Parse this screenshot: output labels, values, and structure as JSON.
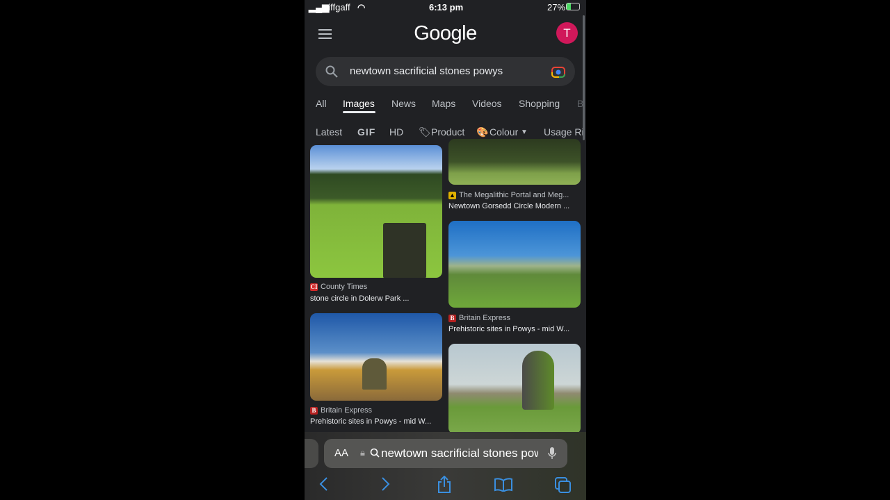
{
  "status_bar": {
    "carrier": "giffgaff",
    "time": "6:13 pm",
    "battery": "27%"
  },
  "header": {
    "logo": "Google",
    "avatar_letter": "T",
    "avatar_color": "#d0185a"
  },
  "search": {
    "query": "newtown sacrificial stones powys"
  },
  "tabs": [
    {
      "label": "All"
    },
    {
      "label": "Images",
      "active": true
    },
    {
      "label": "News"
    },
    {
      "label": "Maps"
    },
    {
      "label": "Videos"
    },
    {
      "label": "Shopping"
    },
    {
      "label": "B"
    }
  ],
  "chips": [
    {
      "label": "Latest"
    },
    {
      "label": "GIF"
    },
    {
      "label": "HD"
    },
    {
      "label": "Product"
    },
    {
      "label": "Colour"
    },
    {
      "label": "Usage Ri"
    }
  ],
  "results": [
    {
      "source": "County Times",
      "favicon": "CI",
      "title": "stone circle in Dolerw Park ..."
    },
    {
      "source": "The Megalithic Portal and Meg...",
      "title": "Newtown Gorsedd Circle Modern ..."
    },
    {
      "source": "Britain Express",
      "favicon": "B",
      "title": "Prehistoric sites in Powys - mid W..."
    },
    {
      "source": "Britain Express",
      "favicon": "B",
      "title": "Prehistoric sites in Powys - mid W..."
    }
  ],
  "browser": {
    "text_size": "AA",
    "url": "newtown sacrificial stones pow"
  }
}
